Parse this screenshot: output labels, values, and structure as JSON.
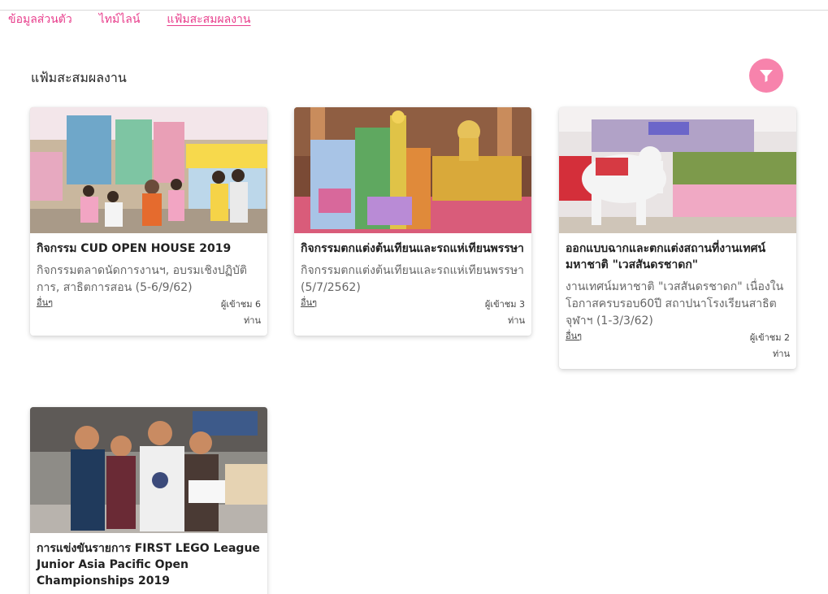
{
  "tabs": [
    {
      "label": "ข้อมูลส่วนตัว"
    },
    {
      "label": "ไทม์ไลน์"
    },
    {
      "label": "แฟ้มสะสมผลงาน"
    }
  ],
  "page": {
    "title": "แฟ้มสะสมผลงาน"
  },
  "filter": {
    "icon": "filter-icon",
    "color": "#f783ac"
  },
  "cards": [
    {
      "title": "กิจกรรม CUD OPEN HOUSE 2019",
      "description": "กิจกรรมตลาดนัดการงานฯ, อบรมเชิงปฏิบัติการ, สาธิตการสอน (5-6/9/62)",
      "more": "อื่นๆ",
      "views": "ผู้เข้าชม 6",
      "views_unit": "ท่าน"
    },
    {
      "title": "กิจกรรมตกแต่งต้นเทียนและรถแห่เทียนพรรษา",
      "description": "กิจกรรมตกแต่งต้นเทียนและรถแห่เทียนพรรษา (5/7/2562)",
      "more": "อื่นๆ",
      "views": "ผู้เข้าชม 3",
      "views_unit": "ท่าน"
    },
    {
      "title": "ออกแบบฉากและตกแต่งสถานที่งานเทศน์มหาชาติ \"เวสสันดรชาดก\"",
      "description": "งานเทศน์มหาชาติ \"เวสสันดรชาดก\" เนื่องในโอกาสครบรอบ60ปี สถาปนาโรงเรียนสาธิตจุฬาฯ (1-3/3/62)",
      "more": "อื่นๆ",
      "views": "ผู้เข้าชม 2",
      "views_unit": "ท่าน"
    },
    {
      "title": "การแข่งขันรายการ FIRST LEGO League Junior Asia Pacific Open Championships 2019"
    }
  ]
}
